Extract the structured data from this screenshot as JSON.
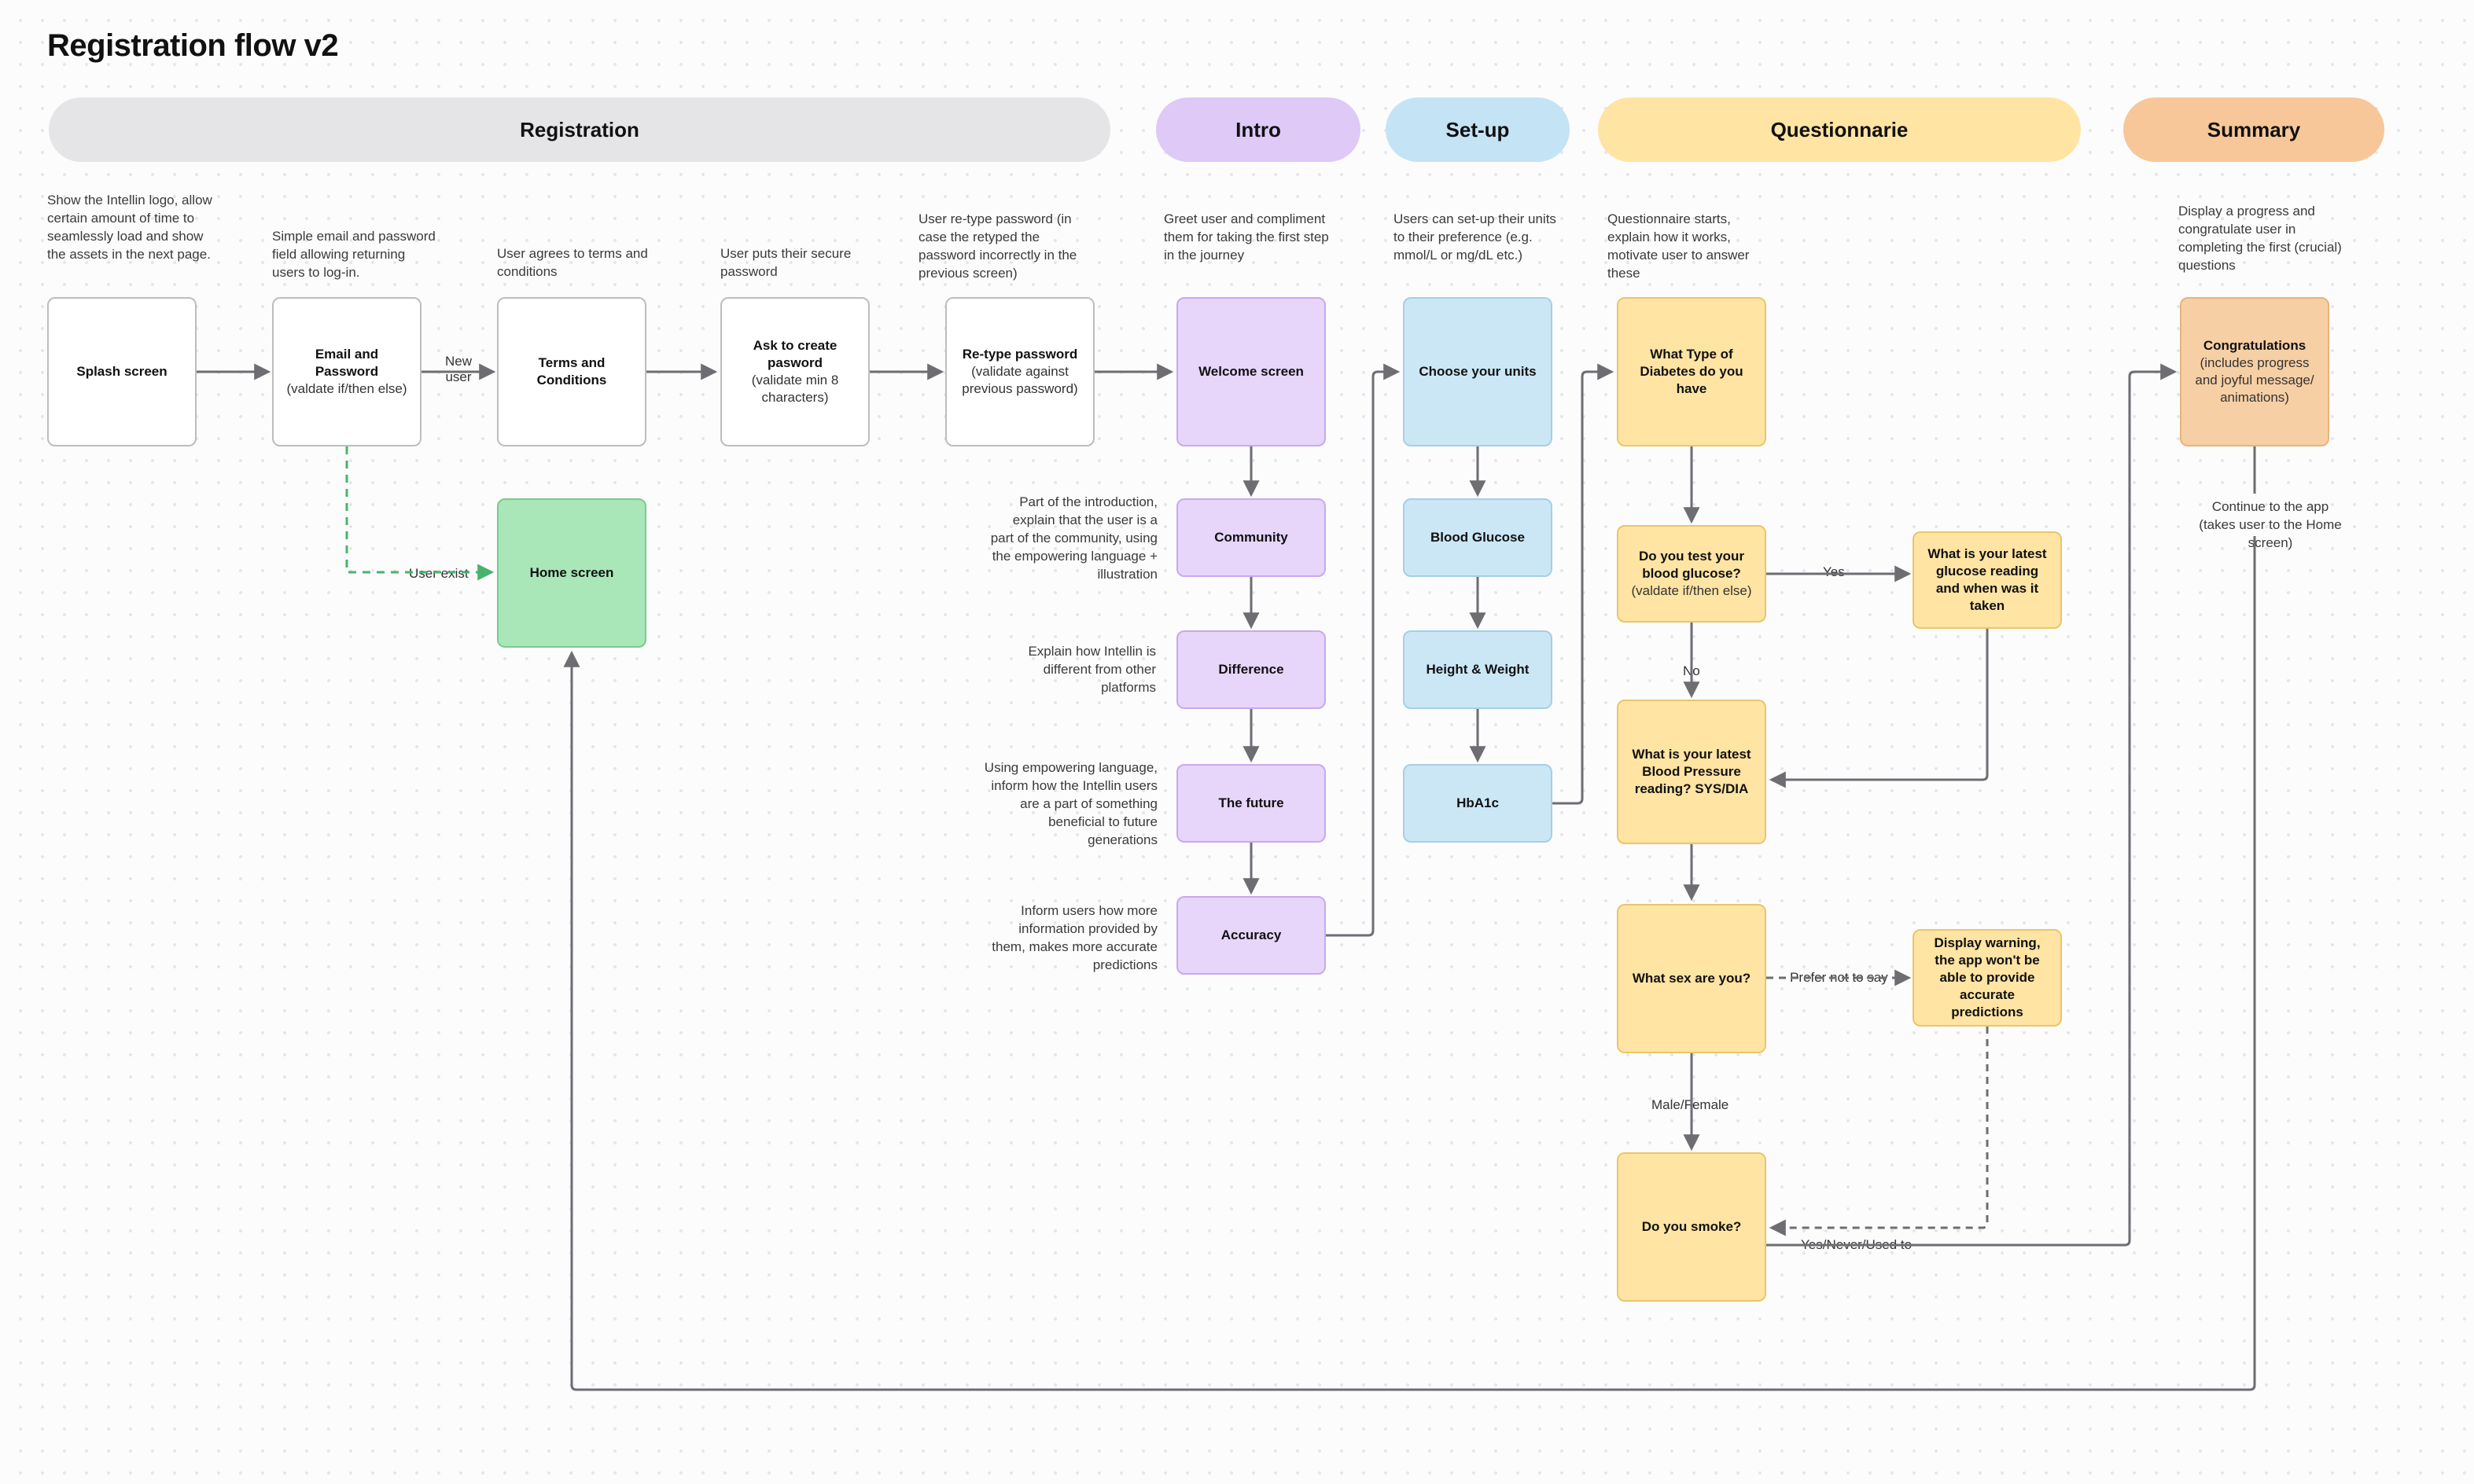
{
  "title": "Registration flow v2",
  "sections": {
    "registration": "Registration",
    "intro": "Intro",
    "setup": "Set-up",
    "questionnaire": "Questionnarie",
    "summary": "Summary"
  },
  "desc": {
    "splash": "Show the Intellin logo, allow certain amount of time to seamlessly load and show the assets in the next page.",
    "emailpwd": "Simple email and password field allowing returning users to log-in.",
    "terms": "User agrees to terms and conditions",
    "createpwd": "User puts their secure password",
    "retypepwd": "User re-type password (in case the retyped the password incorrectly in the previous screen)",
    "welcome": "Greet user and compliment them for taking the first step in the journey",
    "setup": "Users can set-up their units to their preference (e.g. mmol/L or mg/dL etc.)",
    "questionnaire": "Questionnaire starts, explain how it works, motivate user to answer these",
    "summary": "Display a progress and congratulate user in completing the first (crucial) questions",
    "community": "Part of the introduction, explain that the user is a part of the community, using the empowering language + illustration",
    "difference": "Explain how Intellin is different from other platforms",
    "future": "Using empowering language, inform how the Intellin users are a part of something beneficial to future generations",
    "accuracy": "Inform users how more information provided by them, makes more accurate predictions",
    "continue": "Continue to the app",
    "continue2": "(takes user to the Home screen)"
  },
  "nodes": {
    "splash": "Splash screen",
    "emailpwd_t": "Email and Password",
    "emailpwd_s": "(valdate if/then else)",
    "terms": "Terms and Conditions",
    "createpwd_t": "Ask to create pasword",
    "createpwd_s": "(validate min 8 characters)",
    "retypepwd_t": "Re-type password",
    "retypepwd_s": "(validate against previous password)",
    "home": "Home screen",
    "welcome": "Welcome screen",
    "community": "Community",
    "difference": "Difference",
    "future": "The future",
    "accuracy": "Accuracy",
    "units": "Choose your units",
    "glucose": "Blood Glucose",
    "hw": "Height & Weight",
    "hba1c": "HbA1c",
    "q_type": "What Type of Diabetes do you have",
    "q_test_t": "Do you test your blood glucose?",
    "q_test_s": "(valdate if/then else)",
    "q_glucose": "What is your latest glucose reading and when was it taken",
    "q_bp": "What is your latest Blood Pressure reading?\nSYS/DIA",
    "q_sex": "What sex are you?",
    "q_warn": "Display warning, the app won't be able to provide accurate predictions",
    "q_smoke": "Do you smoke?",
    "congrats_t": "Congratulations",
    "congrats_s": "(includes progress and joyful message/ animations)"
  },
  "labels": {
    "new_user": "New\nuser",
    "user_exist": "User exist",
    "yes": "Yes",
    "no": "No",
    "prefer_not": "Prefer not to say",
    "male_female": "Male/Female",
    "smoke_out": "Yes/Never/Used to"
  },
  "colors": {
    "gray_pill": "#e5e5e7",
    "purple": "#e7d5fa",
    "blue": "#cbe7f6",
    "yellow": "#ffe4a3",
    "orange": "#f7cfa5",
    "green": "#a9e6b8"
  }
}
